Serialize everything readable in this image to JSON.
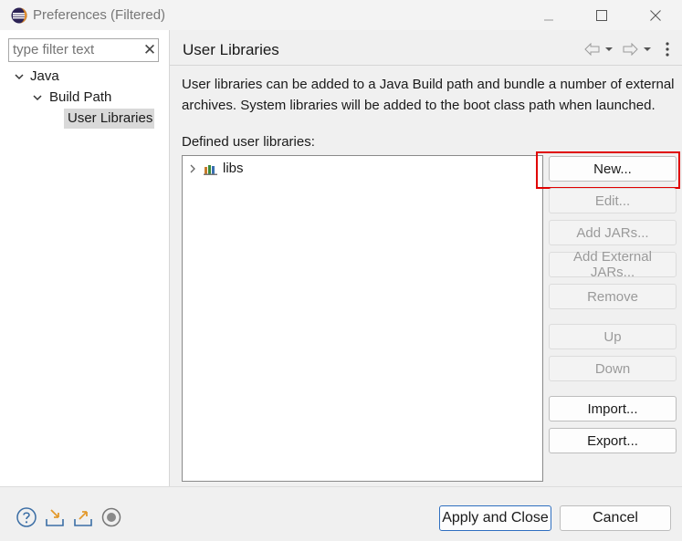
{
  "window": {
    "title": "Preferences (Filtered)"
  },
  "filter": {
    "placeholder": "type filter text"
  },
  "tree": {
    "java": "Java",
    "build_path": "Build Path",
    "user_libraries": "User Libraries"
  },
  "page": {
    "title": "User Libraries",
    "description": "User libraries can be added to a Java Build path and bundle a number of external archives. System libraries will be added to the boot class path when launched.",
    "defined_label": "Defined user libraries:",
    "libraries": [
      "libs"
    ]
  },
  "buttons": {
    "new": "New...",
    "edit": "Edit...",
    "add_jars": "Add JARs...",
    "add_external_jars": "Add External JARs...",
    "remove": "Remove",
    "up": "Up",
    "down": "Down",
    "import": "Import...",
    "export": "Export..."
  },
  "footer": {
    "apply_close": "Apply and Close",
    "cancel": "Cancel"
  },
  "colors": {
    "highlight": "#e00000",
    "selection": "#d9d9d9"
  }
}
